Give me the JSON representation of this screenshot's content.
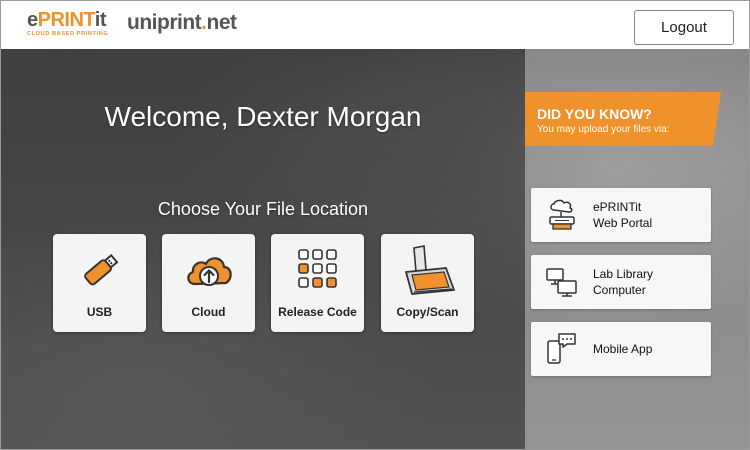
{
  "header": {
    "logo_primary": "ePRINTit",
    "logo_tagline": "CLOUD BASED PRINTING",
    "logo_secondary": "uniprint.net",
    "logout_label": "Logout"
  },
  "main": {
    "welcome": "Welcome, Dexter Morgan",
    "choose_heading": "Choose Your File Location",
    "tiles": [
      {
        "label": "USB",
        "icon": "usb-drive-icon"
      },
      {
        "label": "Cloud",
        "icon": "cloud-upload-icon"
      },
      {
        "label": "Release Code",
        "icon": "keypad-icon"
      },
      {
        "label": "Copy/Scan",
        "icon": "scanner-icon"
      }
    ]
  },
  "sidebar": {
    "did_you_know_title": "DID YOU KNOW?",
    "did_you_know_sub": "You may upload your files via:",
    "cards": [
      {
        "line1": "ePRINTit",
        "line2": "Web Portal",
        "icon": "web-portal-icon"
      },
      {
        "line1": "Lab Library",
        "line2": "Computer",
        "icon": "desktop-computer-icon"
      },
      {
        "line1": "Mobile App",
        "line2": "",
        "icon": "mobile-chat-icon"
      }
    ]
  },
  "colors": {
    "accent": "#f0922b",
    "text_dark": "#222222"
  }
}
